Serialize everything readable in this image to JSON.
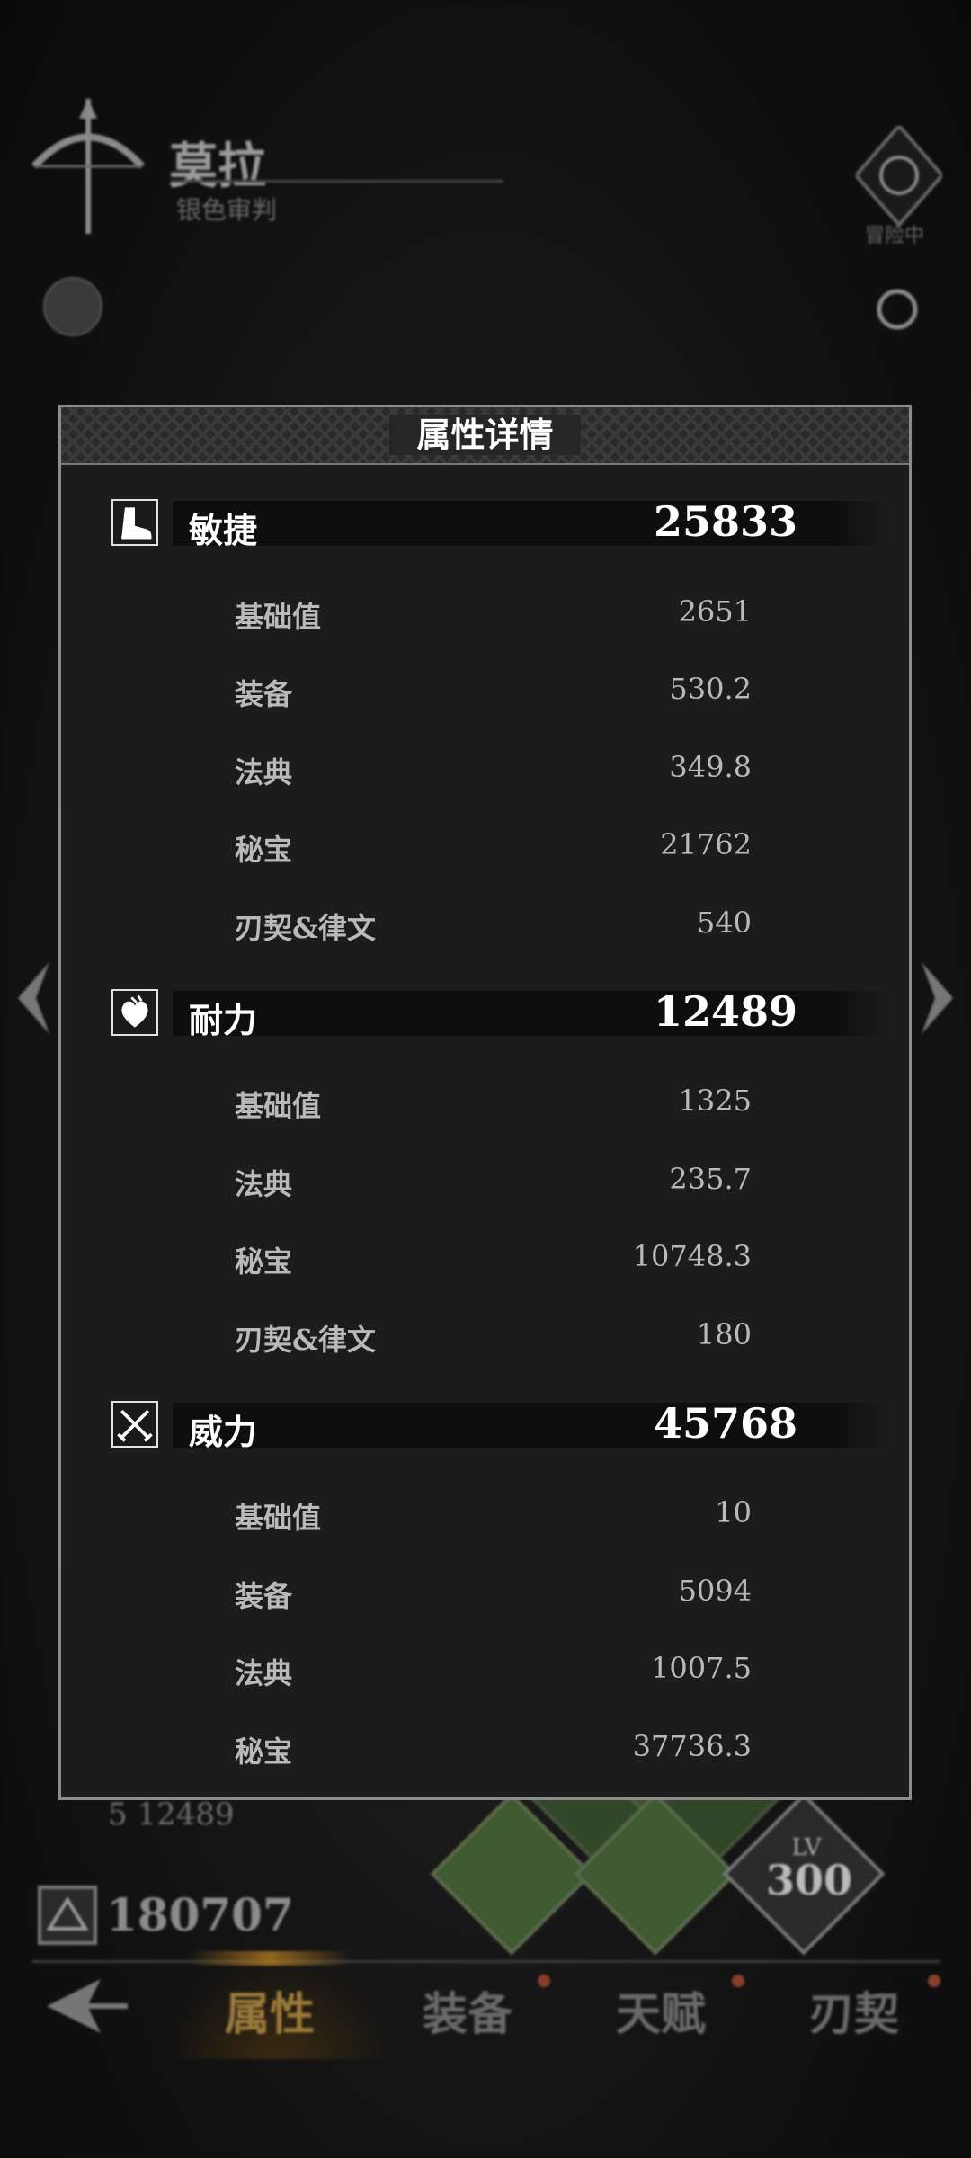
{
  "background": {
    "character_name": "莫拉",
    "character_subtitle": "银色审判",
    "badge_label": "冒险中",
    "endurance_row": "5 12489",
    "power": "180707",
    "level_label": "LV",
    "level_value": "300"
  },
  "nav": {
    "items": [
      "属性",
      "装备",
      "天赋",
      "刃契"
    ],
    "active": "属性"
  },
  "dialog": {
    "title": "属性详情",
    "sections": [
      {
        "name": "敏捷",
        "icon": "boot-icon",
        "total": "25833",
        "rows": [
          {
            "label": "基础值",
            "value": "2651"
          },
          {
            "label": "装备",
            "value": "530.2"
          },
          {
            "label": "法典",
            "value": "349.8"
          },
          {
            "label": "秘宝",
            "value": "21762"
          },
          {
            "label": "刃契&律文",
            "value": "540"
          }
        ]
      },
      {
        "name": "耐力",
        "icon": "heart-icon",
        "total": "12489",
        "rows": [
          {
            "label": "基础值",
            "value": "1325"
          },
          {
            "label": "法典",
            "value": "235.7"
          },
          {
            "label": "秘宝",
            "value": "10748.3"
          },
          {
            "label": "刃契&律文",
            "value": "180"
          }
        ]
      },
      {
        "name": "威力",
        "icon": "crossed-swords-icon",
        "total": "45768",
        "rows": [
          {
            "label": "基础值",
            "value": "10"
          },
          {
            "label": "装备",
            "value": "5094"
          },
          {
            "label": "法典",
            "value": "1007.5"
          },
          {
            "label": "秘宝",
            "value": "37736.3"
          }
        ]
      }
    ]
  }
}
